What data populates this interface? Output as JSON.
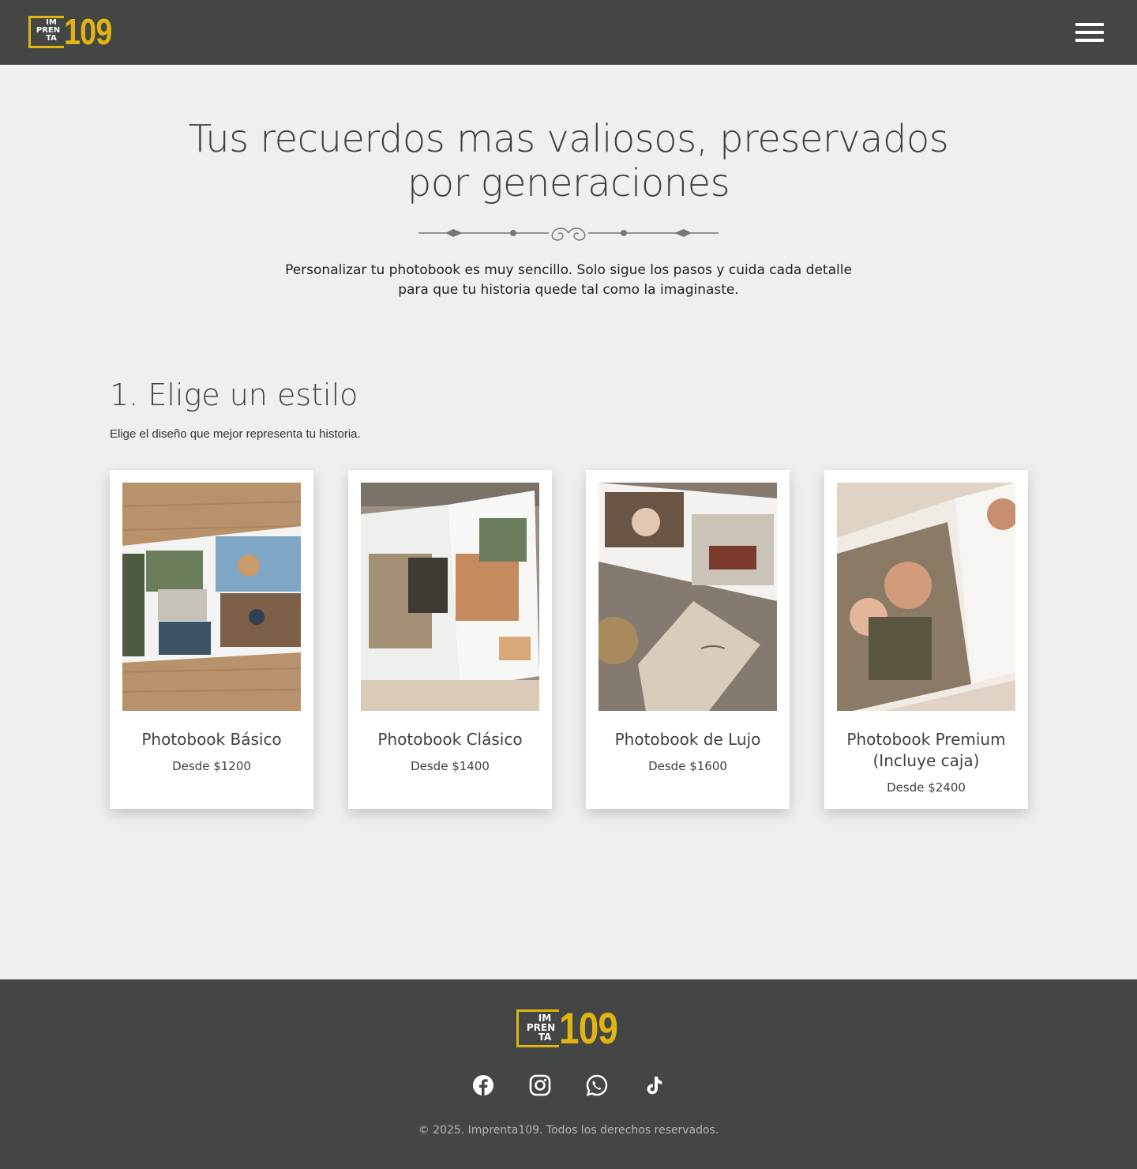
{
  "brand": {
    "logo_letters": "IM PREN TA",
    "logo_number": "109",
    "accent": "#e0b50f",
    "header_bg": "#444545"
  },
  "header": {
    "menu_icon": "hamburger-menu-icon"
  },
  "hero": {
    "title_line1": "Tus recuerdos mas valiosos, preservados",
    "title_line2": "por generaciones",
    "subtitle_line1": "Personalizar tu photobook es muy sencillo. Solo sigue los pasos y cuida cada detalle",
    "subtitle_line2": "para que tu historia quede tal como la imaginaste."
  },
  "step": {
    "title": "1. Elige un estilo",
    "subtitle": "Elige el diseño que mejor representa tu historia."
  },
  "cards": [
    {
      "name": "Photobook Básico",
      "price": "Desde $1200"
    },
    {
      "name": "Photobook Clásico",
      "price": "Desde $1400"
    },
    {
      "name": "Photobook de Lujo",
      "price": "Desde $1600"
    },
    {
      "name": "Photobook Premium (Incluye caja)",
      "price": "Desde $2400"
    }
  ],
  "footer": {
    "social": [
      "facebook-icon",
      "instagram-icon",
      "whatsapp-icon",
      "tiktok-icon"
    ],
    "copyright": "© 2025. Imprenta109. Todos los derechos reservados."
  }
}
